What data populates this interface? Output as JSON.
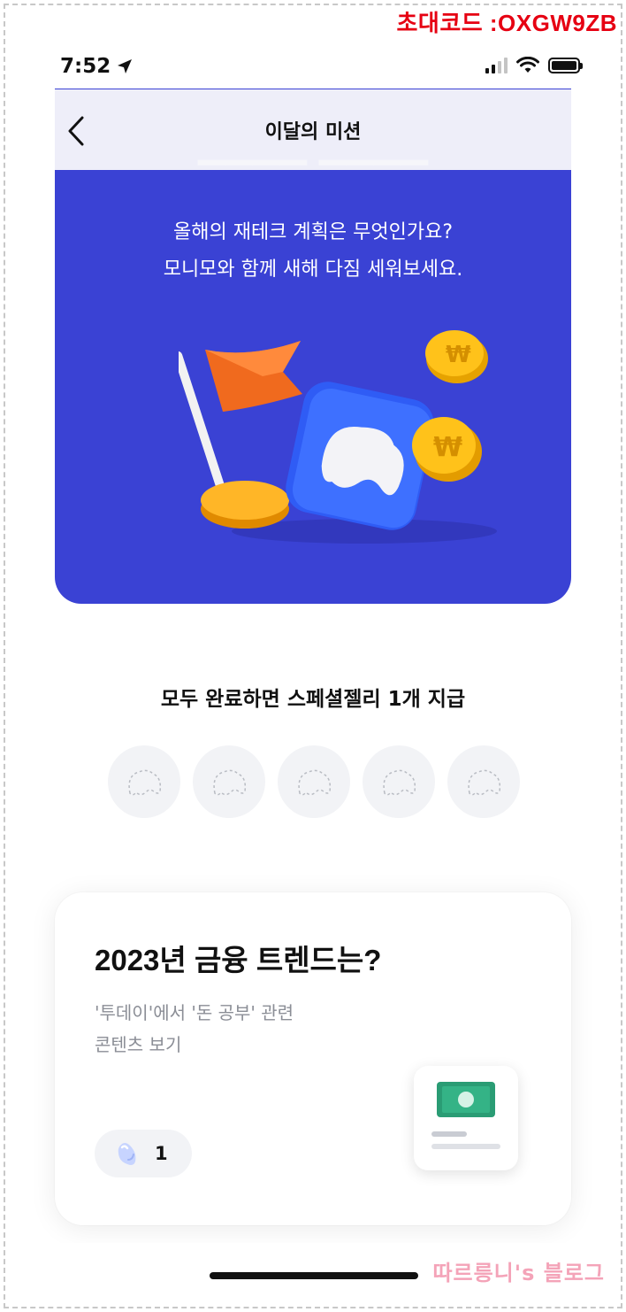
{
  "watermark_top": "초대코드 :OXGW9ZB",
  "status_bar": {
    "time": "7:52",
    "location_icon": "location-arrow-icon",
    "signal_icon": "cellular-signal-icon",
    "wifi_icon": "wifi-icon",
    "battery_icon": "battery-icon"
  },
  "nav": {
    "title": "이달의 미션",
    "back_icon": "chevron-left-icon"
  },
  "hero": {
    "subtitle_line1": "올해의 재테크 계획은 무엇인가요?",
    "subtitle_line2": "모니모와 함께 새해 다짐 세워보세요.",
    "background_color": "#3a42d4",
    "illustration_icon": "flag-coins-illustration"
  },
  "reward": {
    "title": "모두 완료하면 스페셜젤리 1개 지급",
    "slot_icon": "jelly-placeholder-icon",
    "slots": 5
  },
  "mission_card": {
    "title": "2023년 금융 트렌드는?",
    "description_line1": "'투데이'에서 '돈 공부' 관련",
    "description_line2": "콘텐츠 보기",
    "reward_icon": "jelly-icon",
    "reward_count": "1",
    "thumbnail_icon": "money-card-icon"
  },
  "watermark_bottom": "따르릉니's 블로그"
}
